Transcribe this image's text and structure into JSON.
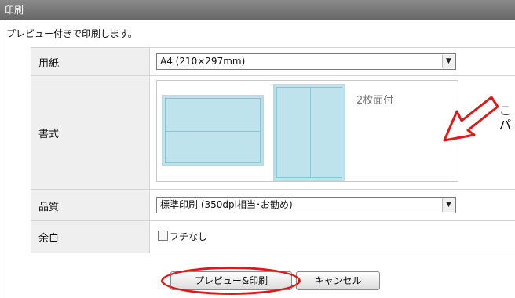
{
  "title": "印刷",
  "subtitle": "プレビュー付きで印刷します。",
  "rows": {
    "paper": {
      "label": "用紙",
      "value": "A4 (210×297mm)"
    },
    "format": {
      "label": "書式",
      "preview_label": "2枚面付"
    },
    "quality": {
      "label": "品質",
      "value": "標準印刷 (350dpi相当･お勧め)"
    },
    "margin": {
      "label": "余白",
      "checkbox_label": "フチなし"
    }
  },
  "buttons": {
    "preview_print": "プレビュー&印刷",
    "cancel": "キャンセル"
  },
  "annotation": {
    "line1": "こ",
    "line2": "パ"
  },
  "colors": {
    "highlight": "#e01818",
    "sheet_fill": "#bfe3ec"
  },
  "icons": {
    "arrow": "left-arrow-outline-icon",
    "dropdown": "chevron-down-icon"
  }
}
